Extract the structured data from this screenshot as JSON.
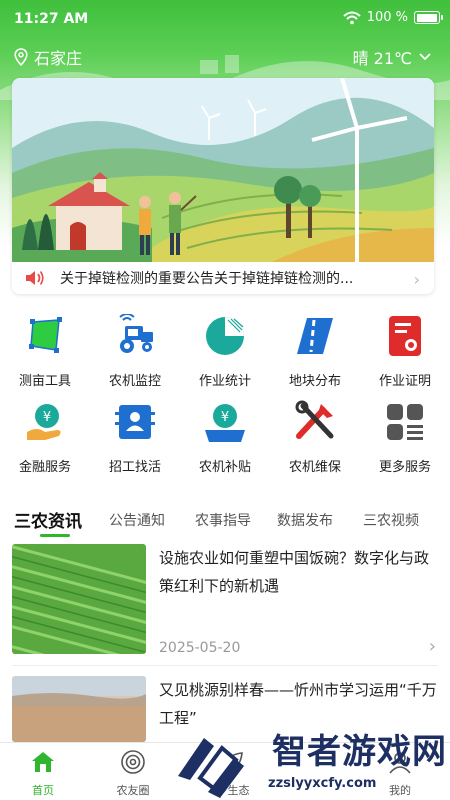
{
  "status": {
    "time": "11:27 AM",
    "battery": "100 %",
    "battery_level": 1.0
  },
  "location": {
    "city": "石家庄",
    "weather": "晴 21℃"
  },
  "banner": {
    "notice": "关于掉链检测的重要公告关于掉链掉链检测的..."
  },
  "shortcuts": [
    {
      "label": "测亩工具",
      "icon": "measure-icon"
    },
    {
      "label": "农机监控",
      "icon": "tractor-monitor-icon"
    },
    {
      "label": "作业统计",
      "icon": "pie-chart-icon"
    },
    {
      "label": "地块分布",
      "icon": "road-map-icon"
    },
    {
      "label": "作业证明",
      "icon": "certificate-icon"
    },
    {
      "label": "金融服务",
      "icon": "finance-icon"
    },
    {
      "label": "招工找活",
      "icon": "recruit-icon"
    },
    {
      "label": "农机补贴",
      "icon": "subsidy-icon"
    },
    {
      "label": "农机维保",
      "icon": "repair-tools-icon"
    },
    {
      "label": "更多服务",
      "icon": "more-services-icon"
    }
  ],
  "tabs": [
    "三农资讯",
    "公告通知",
    "农事指导",
    "数据发布",
    "三农视频"
  ],
  "news": [
    {
      "title": "设施农业如何重塑中国饭碗？数字化与政策红利下的新机遇",
      "date": "2025-05-20"
    },
    {
      "title": "又见桃源别样春——忻州市学习运用“千万工程”",
      "date": ""
    }
  ],
  "nav": [
    {
      "label": "首页",
      "icon": "home-icon"
    },
    {
      "label": "农友圈",
      "icon": "circle-icon"
    },
    {
      "label": "乡生态",
      "icon": "eco-icon"
    },
    {
      "label": "我的",
      "icon": "user-icon"
    }
  ],
  "watermark": {
    "text": "智者游戏网",
    "url": "zzslyyxcfy.com"
  },
  "colors": {
    "brand_green": "#2fb52e",
    "icon_blue": "#1e6fd0",
    "icon_teal": "#1aa99a",
    "icon_red": "#e02b2b"
  }
}
